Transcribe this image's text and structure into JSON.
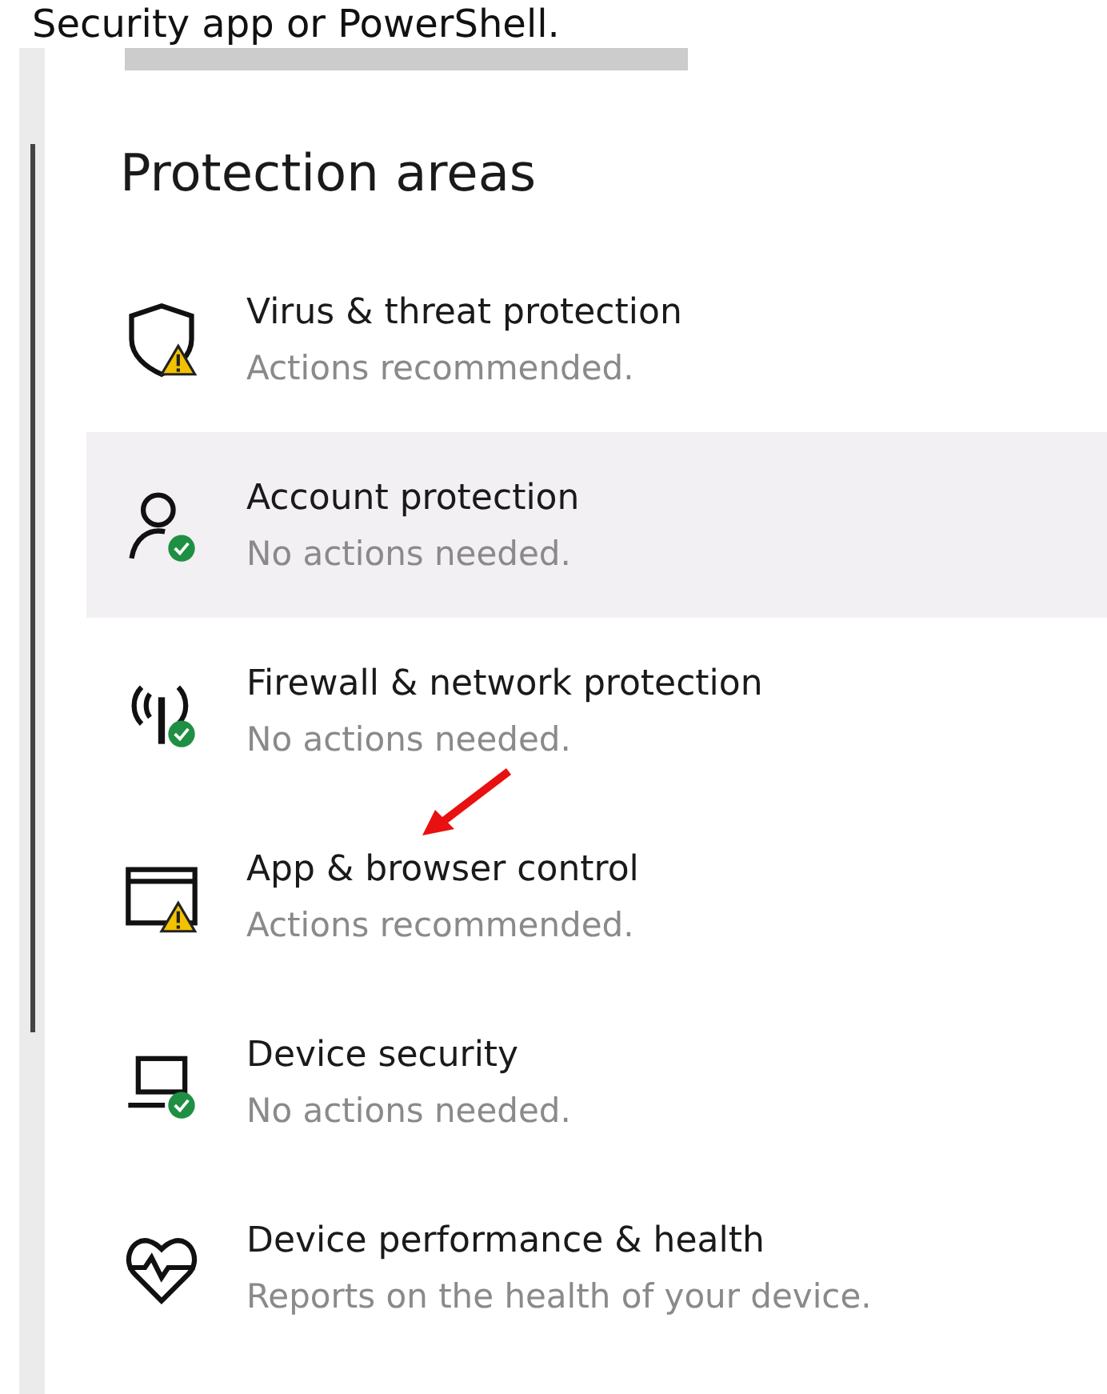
{
  "caption": "Security app or PowerShell.",
  "heading": "Protection areas",
  "items": [
    {
      "kind": "shield",
      "warning": true,
      "healthy": false,
      "title": "Virus & threat protection",
      "subtitle": "Actions recommended.",
      "highlighted": false
    },
    {
      "kind": "person",
      "warning": false,
      "healthy": true,
      "title": "Account protection",
      "subtitle": "No actions needed.",
      "highlighted": true
    },
    {
      "kind": "antenna",
      "warning": false,
      "healthy": true,
      "title": "Firewall & network protection",
      "subtitle": "No actions needed.",
      "highlighted": false
    },
    {
      "kind": "window",
      "warning": true,
      "healthy": false,
      "title": "App & browser control",
      "subtitle": "Actions recommended.",
      "highlighted": false
    },
    {
      "kind": "laptop",
      "warning": false,
      "healthy": true,
      "title": "Device security",
      "subtitle": "No actions needed.",
      "highlighted": false
    },
    {
      "kind": "heart",
      "warning": false,
      "healthy": false,
      "title": "Device performance & health",
      "subtitle": "Reports on the health of your device.",
      "highlighted": false
    }
  ]
}
